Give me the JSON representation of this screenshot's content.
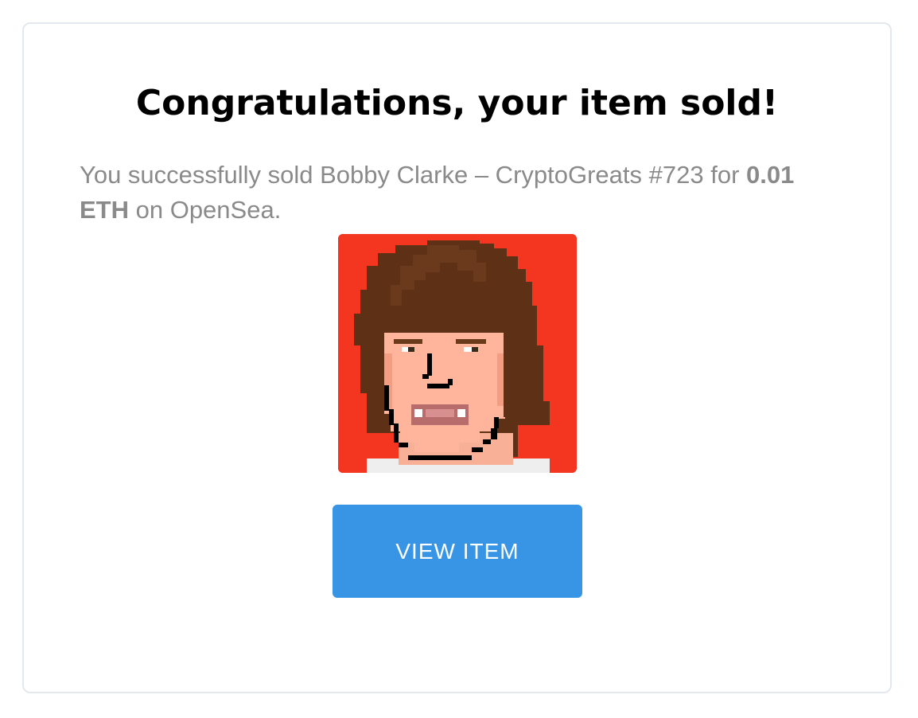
{
  "dialog": {
    "title": "Congratulations, your item sold!",
    "message": {
      "prefix": "You successfully sold Bobby Clarke – CryptoGreats #723 for ",
      "price": "0.01 ETH",
      "suffix": " on OpenSea."
    },
    "button_label": "VIEW ITEM"
  },
  "colors": {
    "card_border": "#e3e8ee",
    "title": "#000000",
    "message_text": "#8a8a8a",
    "button_bg": "#3895e6",
    "button_text": "#ffffff",
    "nft_background": "#f43620"
  },
  "nft_image": {
    "subject": "pixel-art-portrait-long-brown-hair"
  }
}
